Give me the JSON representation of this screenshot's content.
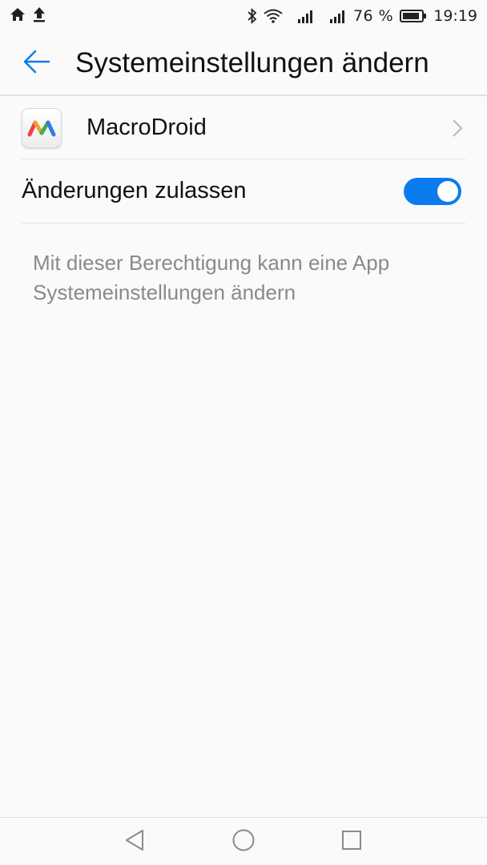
{
  "status_bar": {
    "left_icons": [
      "home-icon",
      "upload-icon"
    ],
    "right_icons": [
      "bluetooth-icon",
      "wifi-icon",
      "signal-icon",
      "signal-icon"
    ],
    "battery_percent": "76 %",
    "time": "19:19"
  },
  "header": {
    "back_icon": "arrow-left-icon",
    "title": "Systemeinstellungen ändern"
  },
  "app": {
    "name": "MacroDroid",
    "icon": "macrodroid-app-icon"
  },
  "permission": {
    "label": "Änderungen zulassen",
    "enabled": true,
    "description": "Mit dieser Berechtigung kann eine App Systemeinstellungen ändern"
  },
  "nav": {
    "back_icon": "triangle-back-icon",
    "home_icon": "circle-home-icon",
    "recents_icon": "square-recents-icon"
  },
  "colors": {
    "accent": "#0a7cf0",
    "background": "#fafafa",
    "secondary_text": "#8a8a8a"
  }
}
